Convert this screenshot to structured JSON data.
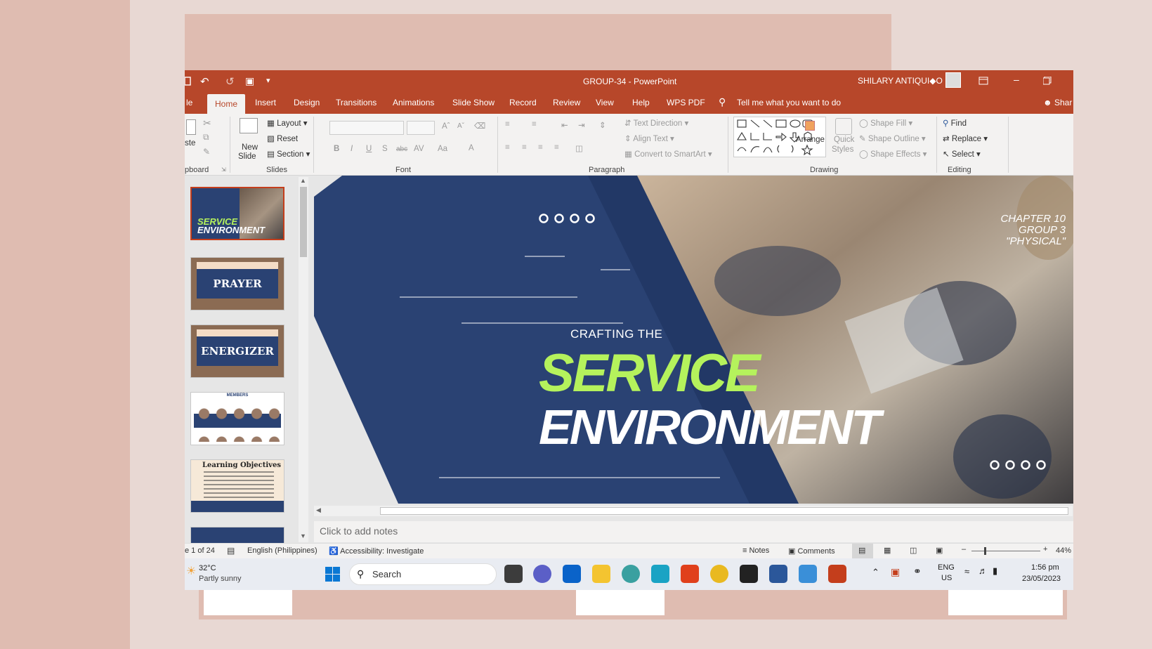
{
  "window": {
    "title": "GROUP-34  -  PowerPoint",
    "user": "SHILARY ANTIQUI◆O"
  },
  "tabs": [
    "le",
    "Home",
    "Insert",
    "Design",
    "Transitions",
    "Animations",
    "Slide Show",
    "Record",
    "Review",
    "View",
    "Help",
    "WPS PDF"
  ],
  "tell_me": "Tell me what you want to do",
  "share": "Shar",
  "ribbon": {
    "clipboard": {
      "paste": "ste",
      "group": "pboard"
    },
    "slides": {
      "new_slide_1": "New",
      "new_slide_2": "Slide",
      "layout": "Layout",
      "reset": "Reset",
      "section": "Section",
      "group": "Slides"
    },
    "font": {
      "group": "Font"
    },
    "paragraph": {
      "text_direction": "Text Direction",
      "align_text": "Align Text",
      "convert_smartart": "Convert to SmartArt",
      "group": "Paragraph"
    },
    "drawing": {
      "arrange": "Arrange",
      "quick_1": "Quick",
      "quick_2": "Styles",
      "shape_fill": "Shape Fill",
      "shape_outline": "Shape Outline",
      "shape_effects": "Shape Effects",
      "group": "Drawing"
    },
    "editing": {
      "find": "Find",
      "replace": "Replace",
      "select": "Select",
      "group": "Editing"
    }
  },
  "thumbnails": [
    {
      "num": "",
      "title_1": "SERVICE",
      "title_2": "ENVIRONMENT"
    },
    {
      "num": "",
      "title": "PRAYER"
    },
    {
      "num": "",
      "title": "ENERGIZER"
    },
    {
      "num": "",
      "title": "MEMBERS"
    },
    {
      "num": "",
      "title": "Learning Objectives"
    }
  ],
  "slide": {
    "subtitle": "CRAFTING THE",
    "title_1": "SERVICE",
    "title_2": "ENVIRONMENT",
    "chapter_1": "CHAPTER  10",
    "chapter_2": "GROUP 3",
    "chapter_3": "\"PHYSICAL\""
  },
  "notes_placeholder": "Click to add notes",
  "status": {
    "slide_count": "e 1 of 24",
    "language": "English (Philippines)",
    "accessibility": "Accessibility: Investigate",
    "notes": "Notes",
    "comments": "Comments",
    "zoom": "44%"
  },
  "taskbar": {
    "temp": "32°C",
    "weather": "Partly sunny",
    "search": "Search",
    "lang_1": "ENG",
    "lang_2": "US",
    "time": "1:56 pm",
    "date": "23/05/2023"
  },
  "colors": {
    "accent": "#b7472a",
    "slide_navy": "#2a4273",
    "title_green": "#b5f25c"
  }
}
